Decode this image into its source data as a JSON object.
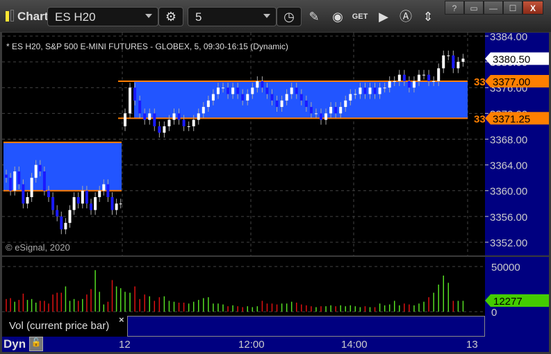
{
  "window": {
    "title": "Chart",
    "buttons": [
      "?",
      "▭",
      "—",
      "☐",
      "X"
    ]
  },
  "toolbar": {
    "symbol": "ES H20",
    "interval": "5"
  },
  "chart": {
    "header": "* ES H20, S&P 500 E-MINI FUTURES - GLOBEX, 5, 09:30-16:15 (Dynamic)",
    "copyright": "© eSignal, 2020",
    "price_ticks": [
      "3384.00",
      "3380.00",
      "3376.00",
      "3372.00",
      "3368.00",
      "3364.00",
      "3360.00",
      "3356.00",
      "3352.00"
    ],
    "last_price": "3380.50",
    "level_high": "3377.00",
    "level_low": "3371.25",
    "level_tag": "33",
    "colors": {
      "zone": "#2255ff",
      "level": "#ff7f00",
      "up": "#ffffff",
      "down": "#1a1aff",
      "vol_up": "#55dd22",
      "vol_down": "#dd1111",
      "axis": "#000080"
    }
  },
  "chart_data": {
    "type": "candlestick",
    "ylim": [
      3350,
      3386
    ],
    "zones": [
      {
        "from": "11",
        "to": "12",
        "low": 3360,
        "high": 3367.5
      },
      {
        "from": "12",
        "to": "13",
        "low": 3371.25,
        "high": 3377
      }
    ],
    "closes_day11": [
      3362,
      3360,
      3363,
      3361,
      3358,
      3359,
      3362,
      3364,
      3363,
      3360,
      3359,
      3357,
      3356,
      3354,
      3355,
      3357,
      3359,
      3358,
      3360,
      3358,
      3357,
      3359,
      3360,
      3361,
      3359,
      3357,
      3358,
      3358
    ],
    "closes_day12": [
      3372,
      3376,
      3374,
      3372,
      3371,
      3372,
      3370,
      3369,
      3370,
      3371,
      3372,
      3371,
      3370,
      3370,
      3371,
      3372,
      3373,
      3374,
      3375,
      3376,
      3376,
      3375,
      3376,
      3375,
      3374,
      3375,
      3376,
      3377,
      3376,
      3375,
      3374,
      3373,
      3374,
      3375,
      3376,
      3375,
      3374,
      3373,
      3372,
      3372,
      3371,
      3372,
      3373,
      3372,
      3373,
      3374,
      3375,
      3375,
      3376,
      3375,
      3376,
      3375,
      3376,
      3376,
      3377,
      3377,
      3378,
      3377,
      3376,
      3377,
      3378,
      3378,
      3377,
      3377,
      3379,
      3381,
      3381,
      3379,
      3380,
      3380.5
    ],
    "volume": [
      14,
      15,
      11,
      13,
      20,
      13,
      14,
      10,
      12,
      12,
      9,
      19,
      21,
      21,
      28,
      12,
      14,
      12,
      14,
      19,
      25,
      46,
      22,
      8,
      11,
      35,
      28,
      26,
      22,
      21,
      28,
      14,
      19,
      17,
      12,
      16,
      17,
      12,
      11,
      10,
      10,
      9,
      11,
      13,
      15,
      16,
      9,
      9,
      8,
      6,
      7,
      6,
      5,
      6,
      5,
      6,
      12,
      9,
      9,
      8,
      9,
      9,
      11,
      10,
      8,
      7,
      6,
      5,
      6,
      6,
      7,
      6,
      7,
      6,
      7,
      6,
      5,
      6,
      5,
      5,
      9,
      7,
      8,
      12,
      7,
      9,
      8,
      7,
      9,
      11,
      16,
      21,
      30,
      40,
      32,
      12,
      12,
      12
    ],
    "vol_ticks": [
      "50000",
      "0"
    ],
    "vol_last": "12277",
    "vol_label": "Vol (current price bar)",
    "x_ticks": [
      "12",
      "12:00",
      "14:00",
      "13"
    ]
  },
  "bottom": {
    "mode": "Dyn"
  }
}
